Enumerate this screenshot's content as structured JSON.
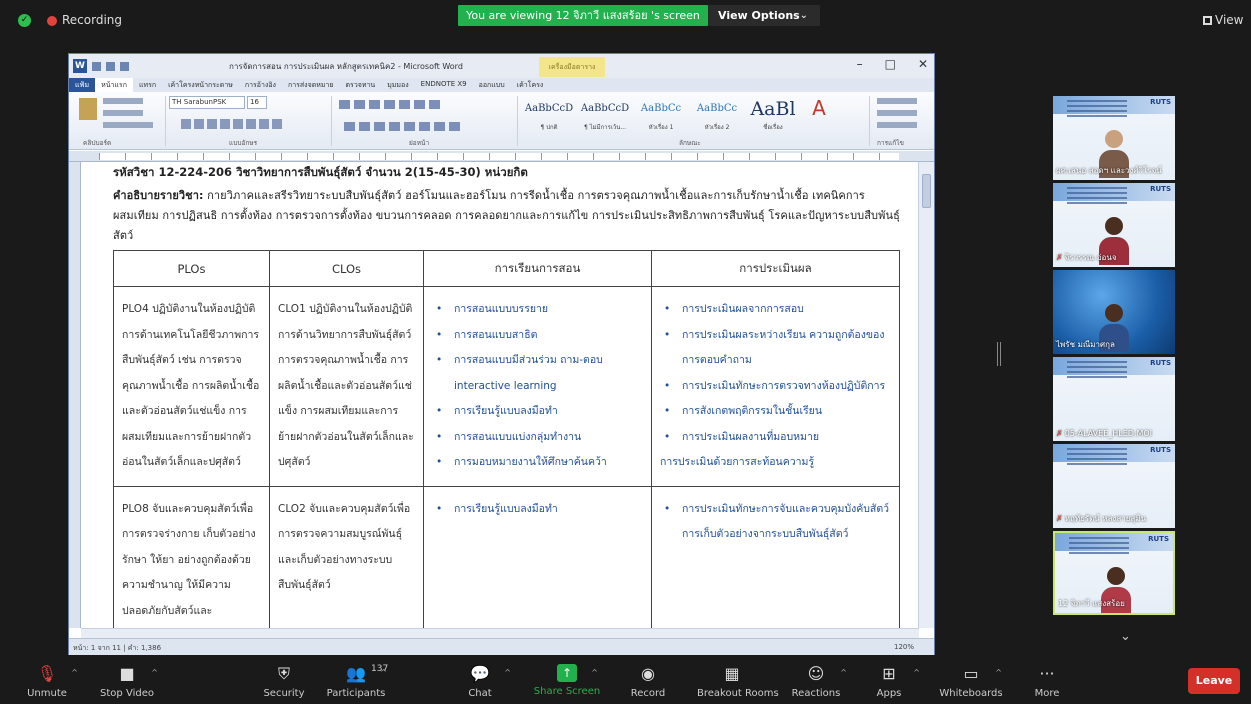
{
  "topbar": {
    "recording_label": "Recording",
    "viewing_banner": "You are viewing 12 จิภาวี แสงสร้อย 's screen",
    "view_options_label": "View Options",
    "view_label": "View"
  },
  "word": {
    "doc_title": "การจัดการสอน การประเมินผล หลักสูตรเทคนิค2 - Microsoft Word",
    "context_tab": "เครื่องมือตาราง",
    "ribbon_tabs": [
      "แฟ้ม",
      "หน้าแรก",
      "แทรก",
      "เค้าโครงหน้ากระดาษ",
      "การอ้างอิง",
      "การส่งจดหมาย",
      "ตรวจทาน",
      "มุมมอง",
      "ENDNOTE X9",
      "ออกแบบ",
      "เค้าโครง"
    ],
    "font_name": "TH SarabunPSK",
    "font_size": "16",
    "groups": {
      "clipboard": "คลิปบอร์ด",
      "font": "แบบอักษร",
      "paragraph": "ย่อหน้า",
      "styles": "ลักษณะ",
      "editing": "การแก้ไข"
    },
    "styles": [
      {
        "sample": "AaBbCcD",
        "name": "¶ ปกติ"
      },
      {
        "sample": "AaBbCcD",
        "name": "¶ ไม่มีการเว้น..."
      },
      {
        "sample": "AaBbCc",
        "name": "หัวเรื่อง 1"
      },
      {
        "sample": "AaBbCc",
        "name": "หัวเรื่อง 2"
      },
      {
        "sample": "AaBl",
        "name": "ชื่อเรื่อง"
      }
    ],
    "status_left": "หน้า: 1 จาก 11  |  คำ: 1,386",
    "status_zoom": "120%"
  },
  "document": {
    "course_title": "รหัสวิชา 12-224-206 วิชาวิทยาการสืบพันธุ์สัตว์ จำนวน 2(15-45-30) หน่วยกิต",
    "desc_label": "คำอธิบายรายวิชา:",
    "desc_text": " กายวิภาคและสรีรวิทยาระบบสืบพันธุ์สัตว์ ฮอร์โมนและฮอร์โมน การรีดน้ำเชื้อ การตรวจคุณภาพน้ำเชื้อและการเก็บรักษาน้ำเชื้อ เทคนิคการผสมเทียม การปฏิสนธิ การตั้งท้อง การตรวจการตั้งท้อง ขบวนการคลอด การคลอดยากและการแก้ไข การประเมินประสิทธิภาพการสืบพันธุ์ โรคและปัญหาระบบสืบพันธุ์สัตว์",
    "table": {
      "headers": [
        "PLOs",
        "CLOs",
        "การเรียนการสอน",
        "การประเมินผล"
      ],
      "rows": [
        {
          "plo": "PLO4 ปฏิบัติงานในห้องปฏิบัติการด้านเทคโนโลยีชีวภาพการสืบพันธุ์สัตว์ เช่น การตรวจคุณภาพน้ำเชื้อ การผลิตน้ำเชื้อและตัวอ่อนสัตว์แช่แข็ง การผสมเทียมและการย้ายฝากตัวอ่อนในสัตว์เล็กและปศุสัตว์",
          "clo": "CLO1 ปฏิบัติงานในห้องปฏิบัติการด้านวิทยาการสืบพันธุ์สัตว์ การตรวจคุณภาพน้ำเชื้อ การผลิตน้ำเชื้อและตัวอ่อนสัตว์แช่แข็ง การผสมเทียมและการย้ายฝากตัวอ่อนในสัตว์เล็กและปศุสัตว์",
          "learning": [
            "การสอนแบบบรรยาย",
            "การสอนแบบสาธิต",
            "การสอนแบบมีส่วนร่วม ถาม-ตอบ interactive learning",
            "การเรียนรู้แบบลงมือทำ",
            "การสอนแบบแบ่งกลุ่มทำงาน",
            "การมอบหมายงานให้ศึกษาค้นคว้า"
          ],
          "evaluation": [
            "การประเมินผลจากการสอบ",
            "การประเมินผลระหว่างเรียน ความถูกต้องของการตอบคำถาม",
            "การประเมินทักษะการตรวจทางห้องปฏิบัติการ",
            "การสังเกตพฤติกรรมในชั้นเรียน",
            "การประเมินผลงานที่มอบหมาย"
          ],
          "evaluation_extra": "การประเมินด้วยการสะท้อนความรู้"
        },
        {
          "plo": "PLO8 จับและควบคุมสัตว์เพื่อการตรวจร่างกาย เก็บตัวอย่าง รักษา ให้ยา อย่างถูกต้องด้วยความชำนาญ ให้มีความปลอดภัยกับสัตว์และ",
          "clo": "CLO2 จับและควบคุมสัตว์เพื่อการตรวจความสมบูรณ์พันธุ์ และเก็บตัวอย่างทางระบบสืบพันธุ์สัตว์",
          "learning": [
            "การเรียนรู้แบบลงมือทำ"
          ],
          "evaluation": [
            "การประเมินทักษะการจับและควบคุมบังคับสัตว์ การเก็บตัวอย่างจากระบบสืบพันธุ์สัตว์"
          ],
          "evaluation_extra": ""
        }
      ]
    }
  },
  "participants": [
    {
      "name": "ผศ.เสนอ สอดฯ และวงศ์วิโรจน์",
      "muted": false,
      "person_color": "#7a5a48",
      "bg": "slide",
      "active": false
    },
    {
      "name": "จิรวรรณ อ่อนจ",
      "muted": true,
      "person_color": "#9d2f3d",
      "bg": "slide",
      "active": false
    },
    {
      "name": "ไพรัช มณีมาศกุล",
      "muted": false,
      "person_color": "#2f4f8a",
      "bg": "sky",
      "active": false
    },
    {
      "name": "05-ALAVEE_HLED.MOI",
      "muted": true,
      "person_color": "#555555",
      "bg": "slide",
      "active": false
    },
    {
      "name": "หฤทัยรัตน์ หลงสายสุมิน",
      "muted": true,
      "person_color": "#6b4c3b",
      "bg": "slide",
      "active": false
    },
    {
      "name": "12 จิภาวี แสงสร้อย",
      "muted": false,
      "person_color": "#b03a48",
      "bg": "slide",
      "active": true
    }
  ],
  "thumb_logo": "RUTS",
  "toolbar": {
    "unmute": "Unmute",
    "stop_video": "Stop Video",
    "security": "Security",
    "participants": "Participants",
    "participants_count": "137",
    "chat": "Chat",
    "share_screen": "Share Screen",
    "record": "Record",
    "breakout_rooms": "Breakout Rooms",
    "reactions": "Reactions",
    "apps": "Apps",
    "whiteboards": "Whiteboards",
    "more": "More",
    "leave": "Leave"
  },
  "colors": {
    "zoom_green": "#23b14d",
    "leave_red": "#d3302a",
    "word_blue": "#2a5699",
    "bullet_blue": "#1f4e9a",
    "active_border": "#c9e66e"
  }
}
